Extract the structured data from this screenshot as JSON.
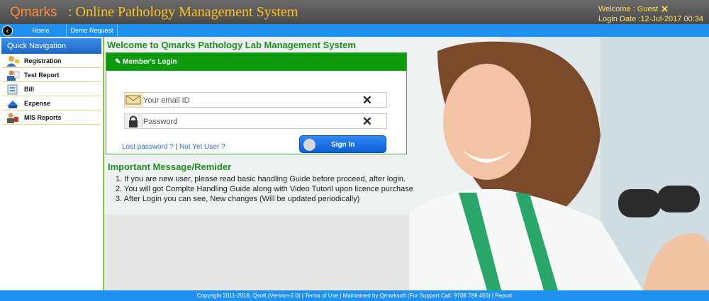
{
  "header": {
    "brand": "Qmarks",
    "system_title": ": Online Pathology Management System",
    "welcome_label": "Welcome : Guest",
    "login_date": "Login Date :12-Jul-2017 00:34"
  },
  "nav": {
    "back_icon": "back-arrow-icon",
    "items": [
      "Home",
      "Demo Request"
    ]
  },
  "sidebar": {
    "title": "Quick Navigation",
    "items": [
      {
        "label": "Registration",
        "icon": "user-icon"
      },
      {
        "label": "Test Report",
        "icon": "report-icon"
      },
      {
        "label": "Bill",
        "icon": "bill-icon"
      },
      {
        "label": "Expense",
        "icon": "expense-icon"
      },
      {
        "label": "MIS Reports",
        "icon": "mis-icon"
      }
    ]
  },
  "main": {
    "welcome_title": "Welcome to Qmarks Pathology Lab Management System",
    "login": {
      "title": "Member's Login",
      "email_placeholder": "Your email ID",
      "password_placeholder": "Password",
      "clear_symbol": "✕",
      "signin_label": "Sign In",
      "lost_password": "Lost password ?",
      "separator": "|",
      "not_yet_user": "Not Yet User ?"
    },
    "important": {
      "title": "Important Message/Remider",
      "items": [
        "1. If you are new user, please read basic handling Guide before proceed, after login.",
        "2. You will got Complte Handling Guide along with Video Tutoril upon licence purchase",
        "3. After Login you can see, New changes (Will be updated periodically)"
      ]
    }
  },
  "footer": {
    "text": "Copyright 2011-2018. Qsoft (Version-2.0) | Terms of Use | Maintained by Qmarksoft (For Support Call: 9708 789 456) | Report"
  },
  "colors": {
    "header_bg": "#555555",
    "brand": "#ff8a3d",
    "title": "#ffc21a",
    "nav_bg": "#1e90f0",
    "green": "#0d9b0d",
    "link": "#2a6fd6"
  }
}
